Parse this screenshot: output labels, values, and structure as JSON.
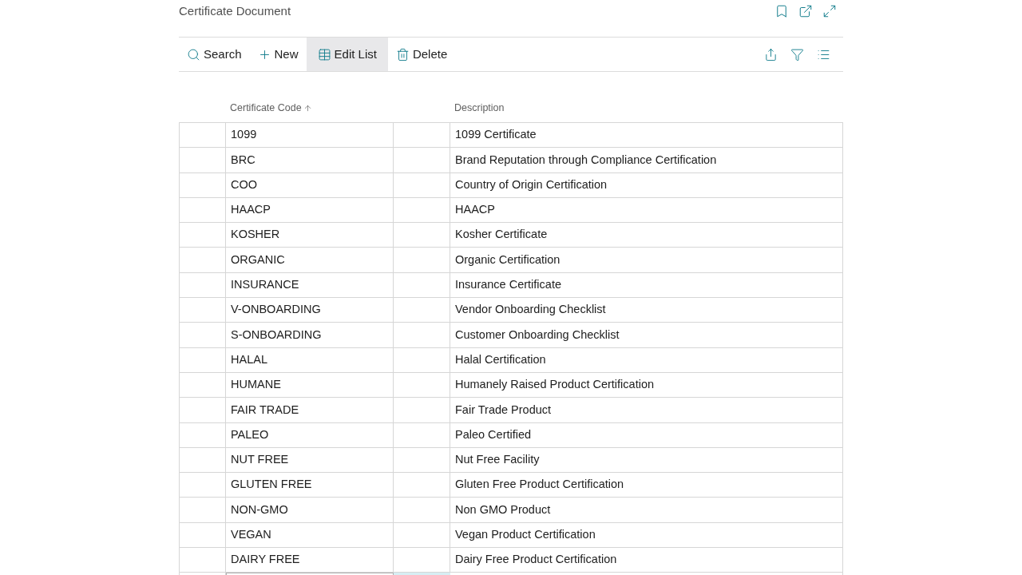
{
  "page": {
    "title": "Certificate Document"
  },
  "toolbar": {
    "actions": [
      {
        "kind": "search",
        "label": "Search",
        "highlighted": false
      },
      {
        "kind": "new",
        "label": "New",
        "highlighted": false
      },
      {
        "kind": "edit",
        "label": "Edit List",
        "highlighted": true
      },
      {
        "kind": "delete",
        "label": "Delete",
        "highlighted": false
      }
    ]
  },
  "table": {
    "columns": [
      {
        "label": "Certificate Code",
        "sorted_ascending": true
      },
      {
        "label": "Description",
        "sorted_ascending": false
      }
    ],
    "rows": [
      {
        "code": "1099",
        "description": "1099 Certificate"
      },
      {
        "code": "BRC",
        "description": "Brand Reputation through Compliance Certification"
      },
      {
        "code": "COO",
        "description": "Country of Origin Certification"
      },
      {
        "code": "HAACP",
        "description": "HAACP"
      },
      {
        "code": "KOSHER",
        "description": "Kosher Certificate"
      },
      {
        "code": "ORGANIC",
        "description": "Organic Certification"
      },
      {
        "code": "INSURANCE",
        "description": "Insurance Certificate"
      },
      {
        "code": "V-ONBOARDING",
        "description": "Vendor Onboarding Checklist"
      },
      {
        "code": "S-ONBOARDING",
        "description": "Customer Onboarding Checklist"
      },
      {
        "code": "HALAL",
        "description": "Halal Certification"
      },
      {
        "code": "HUMANE",
        "description": "Humanely Raised Product Certification"
      },
      {
        "code": "FAIR TRADE",
        "description": "Fair Trade Product"
      },
      {
        "code": "PALEO",
        "description": "Paleo Certified"
      },
      {
        "code": "NUT FREE",
        "description": "Nut Free Facility"
      },
      {
        "code": "GLUTEN FREE",
        "description": "Gluten Free Product Certification"
      },
      {
        "code": "NON-GMO",
        "description": "Non GMO Product"
      },
      {
        "code": "VEGAN",
        "description": "Vegan Product Certification"
      },
      {
        "code": "DAIRY FREE",
        "description": "Dairy Free Product Certification"
      }
    ]
  }
}
